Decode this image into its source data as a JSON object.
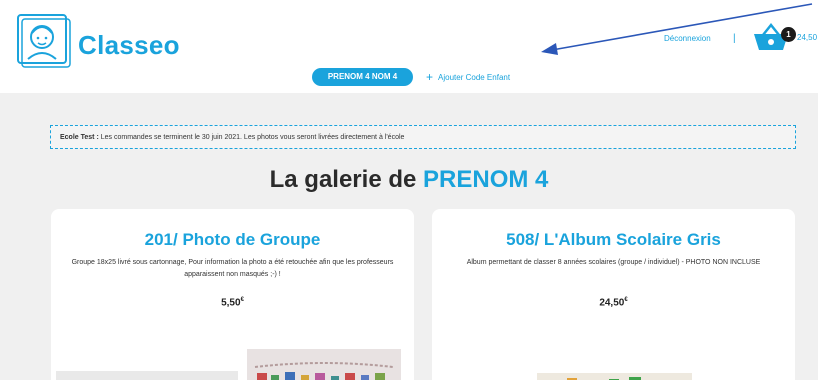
{
  "header": {
    "brand": "Classeo",
    "logout_label": "Déconnexion",
    "separator": "|",
    "cart": {
      "count": "1",
      "total": "24,50"
    },
    "child_pill": "PRENOM 4 NOM 4",
    "add_child_label": "Ajouter Code Enfant",
    "add_icon": "+"
  },
  "notice": {
    "school": "Ecole Test :",
    "message": "Les commandes se terminent le 30 juin 2021. Les photos vous seront livrées directement à l'école"
  },
  "gallery": {
    "title_prefix": "La galerie de",
    "title_name": "PRENOM 4"
  },
  "products": [
    {
      "title": "201/ Photo de Groupe",
      "description": "Groupe 18x25 livré sous cartonnage, Pour information la photo a été retouchée afin que les professeurs apparaissent non masqués ;-) !",
      "price": "5,50",
      "currency": "€"
    },
    {
      "title": "508/ L'Album Scolaire Gris",
      "description": "Album permettant de classer 8 années scolaires (groupe / individuel) - PHOTO NON INCLUSE",
      "price": "24,50",
      "currency": "€"
    }
  ],
  "colors": {
    "accent": "#1aa3dc",
    "annotation_arrow": "#2b57b8"
  }
}
